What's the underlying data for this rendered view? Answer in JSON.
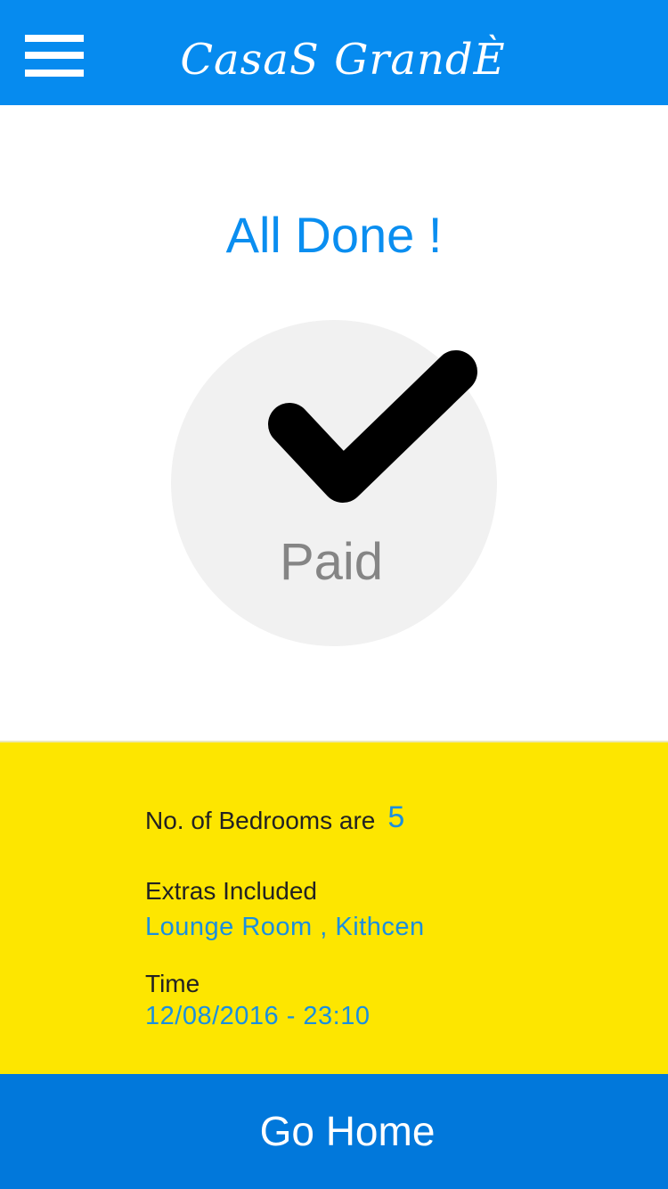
{
  "header": {
    "menu_icon": "hamburger-menu-icon",
    "brand": "CasaS GrandÈ"
  },
  "status": {
    "title": "All Done !",
    "badge_icon": "checkmark-icon",
    "badge_label": "Paid"
  },
  "details": {
    "bedrooms_label": "No. of Bedrooms  are",
    "bedrooms_count": "5",
    "extras_label": "Extras Included",
    "extras_value": "Lounge Room , Kithcen",
    "time_label": "Time",
    "time_value": "12/08/2016 - 23:10"
  },
  "footer": {
    "go_home_label": "Go Home"
  },
  "colors": {
    "header_bg": "#068bef",
    "accent_text": "#0a8ef0",
    "details_bg": "#fde600",
    "footer_bg": "#0178db",
    "badge_bg": "#f1f1f1"
  }
}
